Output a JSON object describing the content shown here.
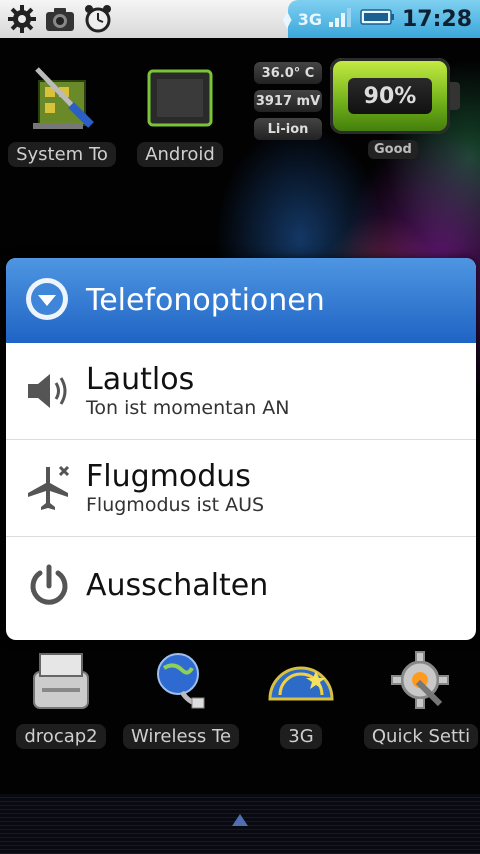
{
  "status_bar": {
    "network": "3G",
    "time": "17:28"
  },
  "home_top": {
    "apps": [
      {
        "label": "System To"
      },
      {
        "label": "Android"
      }
    ],
    "battery_widget": {
      "temperature": "36.0° C",
      "voltage": "3917 mV",
      "type": "Li-ion",
      "level": "90%",
      "health": "Good"
    }
  },
  "dialog": {
    "title": "Telefonoptionen",
    "options": [
      {
        "title": "Lautlos",
        "subtitle": "Ton ist momentan AN"
      },
      {
        "title": "Flugmodus",
        "subtitle": "Flugmodus ist AUS"
      },
      {
        "title": "Ausschalten"
      }
    ]
  },
  "home_bottom": {
    "apps": [
      {
        "label": "drocap2"
      },
      {
        "label": "Wireless Te"
      },
      {
        "label": "3G"
      },
      {
        "label": "Quick Setti"
      }
    ]
  }
}
